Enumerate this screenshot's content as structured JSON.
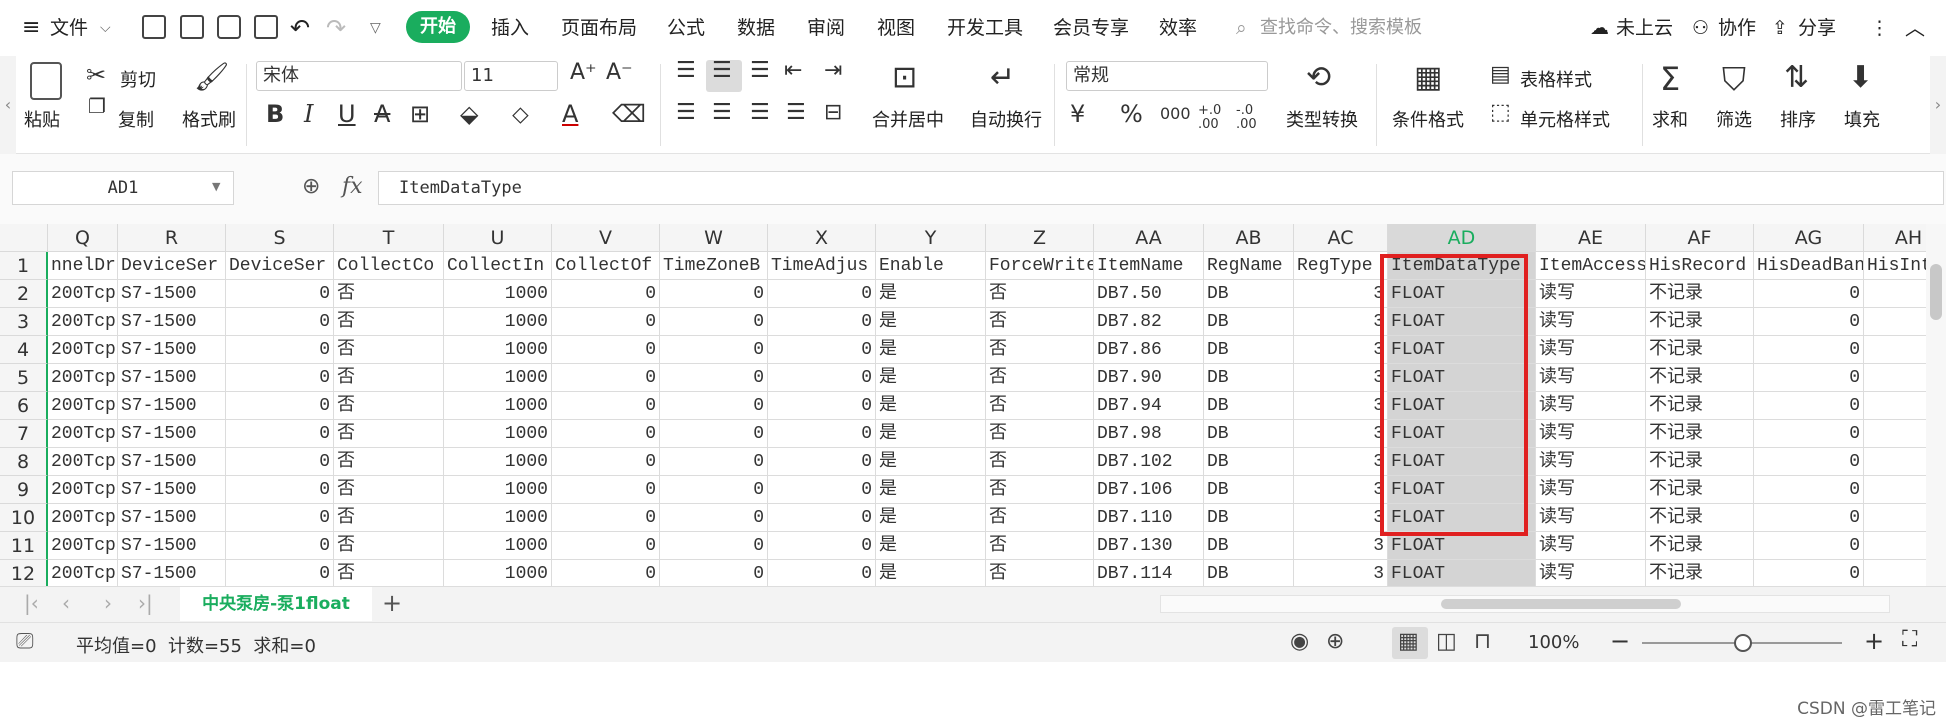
{
  "menu": {
    "file": "文件",
    "start": "开始",
    "tabs": [
      "插入",
      "页面布局",
      "公式",
      "数据",
      "审阅",
      "视图",
      "开发工具",
      "会员专享",
      "效率"
    ],
    "search_placeholder": "查找命令、搜索模板",
    "cloud": "未上云",
    "collab": "协作",
    "share": "分享"
  },
  "ribbon": {
    "paste": "粘贴",
    "cut": "剪切",
    "copy": "复制",
    "format_painter": "格式刷",
    "font_name": "宋体",
    "font_size": "11",
    "merge_center": "合并居中",
    "wrap_text": "自动换行",
    "number_format": "常规",
    "type_convert": "类型转换",
    "cond_format": "条件格式",
    "table_style": "表格样式",
    "cell_style": "单元格样式",
    "sum": "求和",
    "filter": "筛选",
    "sort": "排序",
    "fill": "填充",
    "currency_icon": "¥",
    "percent_icon": "%",
    "thousands_icon": "000",
    "inc_decimal_icon": "+.0 .00",
    "dec_decimal_icon": "-.0 .00"
  },
  "formula_bar": {
    "name_box": "AD1",
    "fx": "fx",
    "value": "ItemDataType"
  },
  "columns": [
    "Q",
    "R",
    "S",
    "T",
    "U",
    "V",
    "W",
    "X",
    "Y",
    "Z",
    "AA",
    "AB",
    "AC",
    "AD",
    "AE",
    "AF",
    "AG",
    "AH"
  ],
  "rows": [
    {
      "n": "1",
      "cells": [
        "nnelDri",
        "DeviceSer",
        "DeviceSer",
        "CollectCo",
        "CollectIn",
        "CollectOf",
        "TimeZoneB",
        "TimeAdjus",
        "Enable",
        "ForceWrite",
        "ItemName",
        "RegName",
        "RegType",
        "ItemDataType",
        "ItemAccess",
        "HisRecord",
        "HisDeadBan",
        "HisInt"
      ]
    },
    {
      "n": "2",
      "cells": [
        "200Tcp",
        "S7-1500",
        "0",
        "否",
        "1000",
        "0",
        "0",
        "0",
        "是",
        "否",
        "DB7.50",
        "DB",
        "3",
        "FLOAT",
        "读写",
        "不记录",
        "0",
        ""
      ]
    },
    {
      "n": "3",
      "cells": [
        "200Tcp",
        "S7-1500",
        "0",
        "否",
        "1000",
        "0",
        "0",
        "0",
        "是",
        "否",
        "DB7.82",
        "DB",
        "3",
        "FLOAT",
        "读写",
        "不记录",
        "0",
        ""
      ]
    },
    {
      "n": "4",
      "cells": [
        "200Tcp",
        "S7-1500",
        "0",
        "否",
        "1000",
        "0",
        "0",
        "0",
        "是",
        "否",
        "DB7.86",
        "DB",
        "3",
        "FLOAT",
        "读写",
        "不记录",
        "0",
        ""
      ]
    },
    {
      "n": "5",
      "cells": [
        "200Tcp",
        "S7-1500",
        "0",
        "否",
        "1000",
        "0",
        "0",
        "0",
        "是",
        "否",
        "DB7.90",
        "DB",
        "3",
        "FLOAT",
        "读写",
        "不记录",
        "0",
        ""
      ]
    },
    {
      "n": "6",
      "cells": [
        "200Tcp",
        "S7-1500",
        "0",
        "否",
        "1000",
        "0",
        "0",
        "0",
        "是",
        "否",
        "DB7.94",
        "DB",
        "3",
        "FLOAT",
        "读写",
        "不记录",
        "0",
        ""
      ]
    },
    {
      "n": "7",
      "cells": [
        "200Tcp",
        "S7-1500",
        "0",
        "否",
        "1000",
        "0",
        "0",
        "0",
        "是",
        "否",
        "DB7.98",
        "DB",
        "3",
        "FLOAT",
        "读写",
        "不记录",
        "0",
        ""
      ]
    },
    {
      "n": "8",
      "cells": [
        "200Tcp",
        "S7-1500",
        "0",
        "否",
        "1000",
        "0",
        "0",
        "0",
        "是",
        "否",
        "DB7.102",
        "DB",
        "3",
        "FLOAT",
        "读写",
        "不记录",
        "0",
        ""
      ]
    },
    {
      "n": "9",
      "cells": [
        "200Tcp",
        "S7-1500",
        "0",
        "否",
        "1000",
        "0",
        "0",
        "0",
        "是",
        "否",
        "DB7.106",
        "DB",
        "3",
        "FLOAT",
        "读写",
        "不记录",
        "0",
        ""
      ]
    },
    {
      "n": "10",
      "cells": [
        "200Tcp",
        "S7-1500",
        "0",
        "否",
        "1000",
        "0",
        "0",
        "0",
        "是",
        "否",
        "DB7.110",
        "DB",
        "3",
        "FLOAT",
        "读写",
        "不记录",
        "0",
        ""
      ]
    },
    {
      "n": "11",
      "cells": [
        "200Tcp",
        "S7-1500",
        "0",
        "否",
        "1000",
        "0",
        "0",
        "0",
        "是",
        "否",
        "DB7.130",
        "DB",
        "3",
        "FLOAT",
        "读写",
        "不记录",
        "0",
        ""
      ]
    },
    {
      "n": "12",
      "cells": [
        "200Tcp",
        "S7-1500",
        "0",
        "否",
        "1000",
        "0",
        "0",
        "0",
        "是",
        "否",
        "DB7.114",
        "DB",
        "3",
        "FLOAT",
        "读写",
        "不记录",
        "0",
        ""
      ]
    }
  ],
  "sheet_tab": "中央泵房-泵1float",
  "status": {
    "stats": "平均值=0  计数=55  求和=0",
    "zoom": "100%"
  },
  "watermark": "CSDN @雷工笔记",
  "colors": {
    "accent": "#1aad5e",
    "highlight": "#e02020",
    "selected_col": "#d4d4d4"
  }
}
